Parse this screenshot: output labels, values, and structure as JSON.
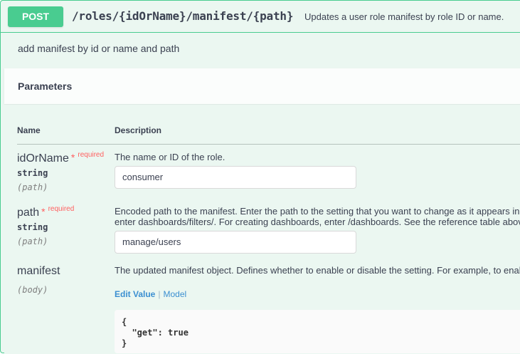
{
  "operation": {
    "method": "POST",
    "path": "/roles/{idOrName}/manifest/{path}",
    "summary": "Updates a user role manifest by role ID or name.",
    "description": "add manifest by id or name and path"
  },
  "parameters_section": {
    "title": "Parameters",
    "col_name": "Name",
    "col_description": "Description"
  },
  "params": [
    {
      "name": "idOrName",
      "required_mark": "*",
      "required_label": "required",
      "type": "string",
      "in": "(path)",
      "description": "The name or ID of the role.",
      "value": "consumer"
    },
    {
      "name": "path",
      "required_mark": "*",
      "required_label": "required",
      "type": "string",
      "in": "(path)",
      "description_line1": "Encoded path to the manifest. Enter the path to the setting that you want to change as it appears in",
      "description_line2": "enter dashboards/filters/. For creating dashboards, enter /dashboards. See the reference table abov",
      "value": "manage/users"
    },
    {
      "name": "manifest",
      "in": "(body)",
      "description": "The updated manifest object. Defines whether to enable or disable the setting. For example, to enal",
      "tab_edit": "Edit Value",
      "tab_separator": "|",
      "tab_model": "Model",
      "body": "{\n  \"get\": true\n}"
    }
  ],
  "colors": {
    "post": "#49cc90",
    "post_bg": "#ebf7f1",
    "required": "#ff6060",
    "link": "#3b8fd1"
  }
}
